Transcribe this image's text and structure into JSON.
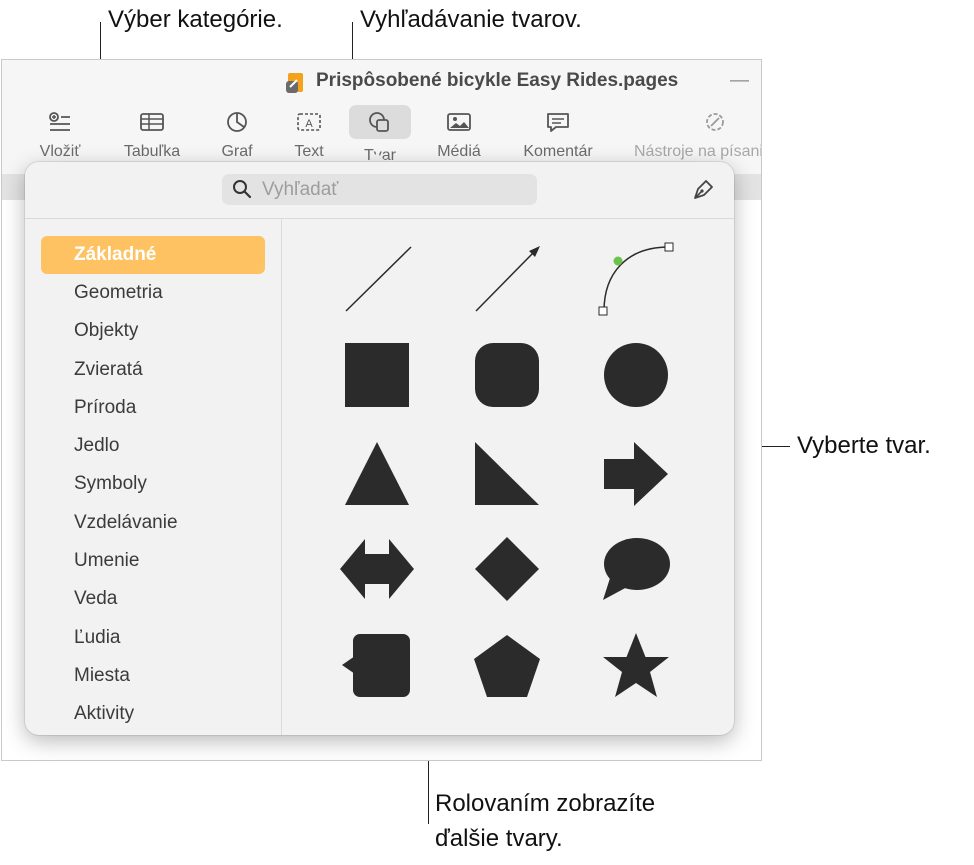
{
  "callouts": {
    "category_picker": "Výber kategórie.",
    "shape_search": "Vyhľadávanie tvarov.",
    "choose_shape": "Vyberte tvar.",
    "scroll_more_line1": "Rolovaním zobrazíte",
    "scroll_more_line2": "ďalšie tvary."
  },
  "window": {
    "title": "Prispôsobené bicykle Easy Rides.pages",
    "title_suffix": "—"
  },
  "toolbar": {
    "items": [
      {
        "label": "Vložiť",
        "icon": "insert-icon"
      },
      {
        "label": "Tabuľka",
        "icon": "table-icon"
      },
      {
        "label": "Graf",
        "icon": "chart-icon"
      },
      {
        "label": "Text",
        "icon": "text-box-icon"
      },
      {
        "label": "Tvar",
        "icon": "shape-icon"
      },
      {
        "label": "Médiá",
        "icon": "media-icon"
      },
      {
        "label": "Komentár",
        "icon": "comment-icon"
      },
      {
        "label": "Nástroje na písanie",
        "icon": "writing-tools-icon"
      }
    ]
  },
  "shapes_popover": {
    "search_placeholder": "Vyhľadať",
    "categories": [
      "Základné",
      "Geometria",
      "Objekty",
      "Zvieratá",
      "Príroda",
      "Jedlo",
      "Symboly",
      "Vzdelávanie",
      "Umenie",
      "Veda",
      "Ľudia",
      "Miesta",
      "Aktivity"
    ],
    "selected_category": "Základné",
    "shapes": [
      "line",
      "arrow-line",
      "curve",
      "square",
      "rounded-square",
      "circle",
      "triangle",
      "right-triangle",
      "arrow-right",
      "double-arrow",
      "diamond",
      "speech-bubble",
      "callout-square",
      "pentagon",
      "star"
    ],
    "shape_fill": "#2b2b2b",
    "accent": "#ffc262"
  }
}
